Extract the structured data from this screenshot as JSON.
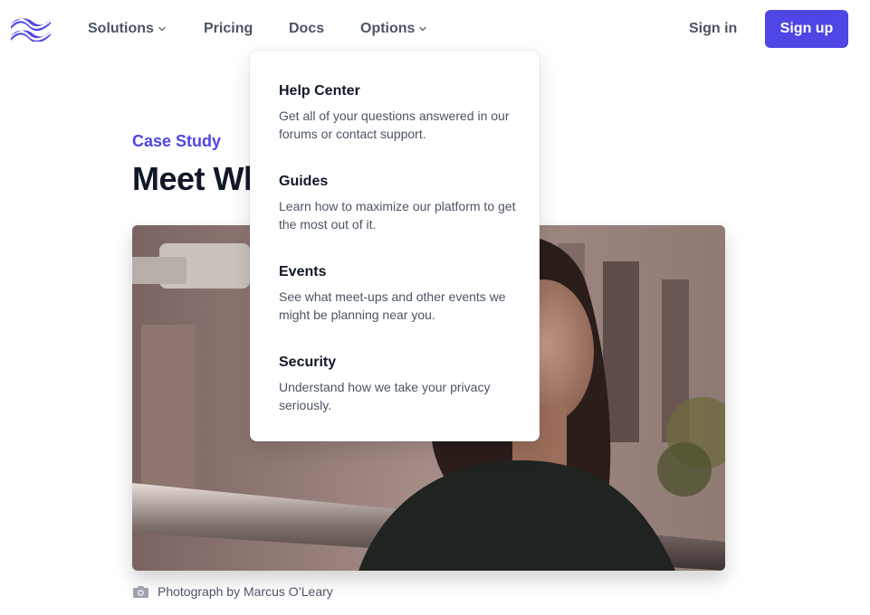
{
  "header": {
    "nav": {
      "solutions": "Solutions",
      "pricing": "Pricing",
      "docs": "Docs",
      "options": "Options"
    },
    "sign_in": "Sign in",
    "sign_up": "Sign up"
  },
  "article": {
    "eyebrow": "Case Study",
    "title": "Meet Wh",
    "caption": "Photograph by Marcus O’Leary"
  },
  "options_menu": {
    "items": [
      {
        "title": "Help Center",
        "description": "Get all of your questions answered in our forums or contact support."
      },
      {
        "title": "Guides",
        "description": "Learn how to maximize our platform to get the most out of it."
      },
      {
        "title": "Events",
        "description": "See what meet-ups and other events we might be planning near you."
      },
      {
        "title": "Security",
        "description": "Understand how we take your privacy seriously."
      }
    ]
  },
  "colors": {
    "accent": "#4f46e5",
    "text": "#111827",
    "muted": "#4b5563"
  },
  "icons": {
    "logo": "tailwind-waves-logo",
    "chevron": "chevron-down-icon",
    "camera": "camera-icon"
  }
}
